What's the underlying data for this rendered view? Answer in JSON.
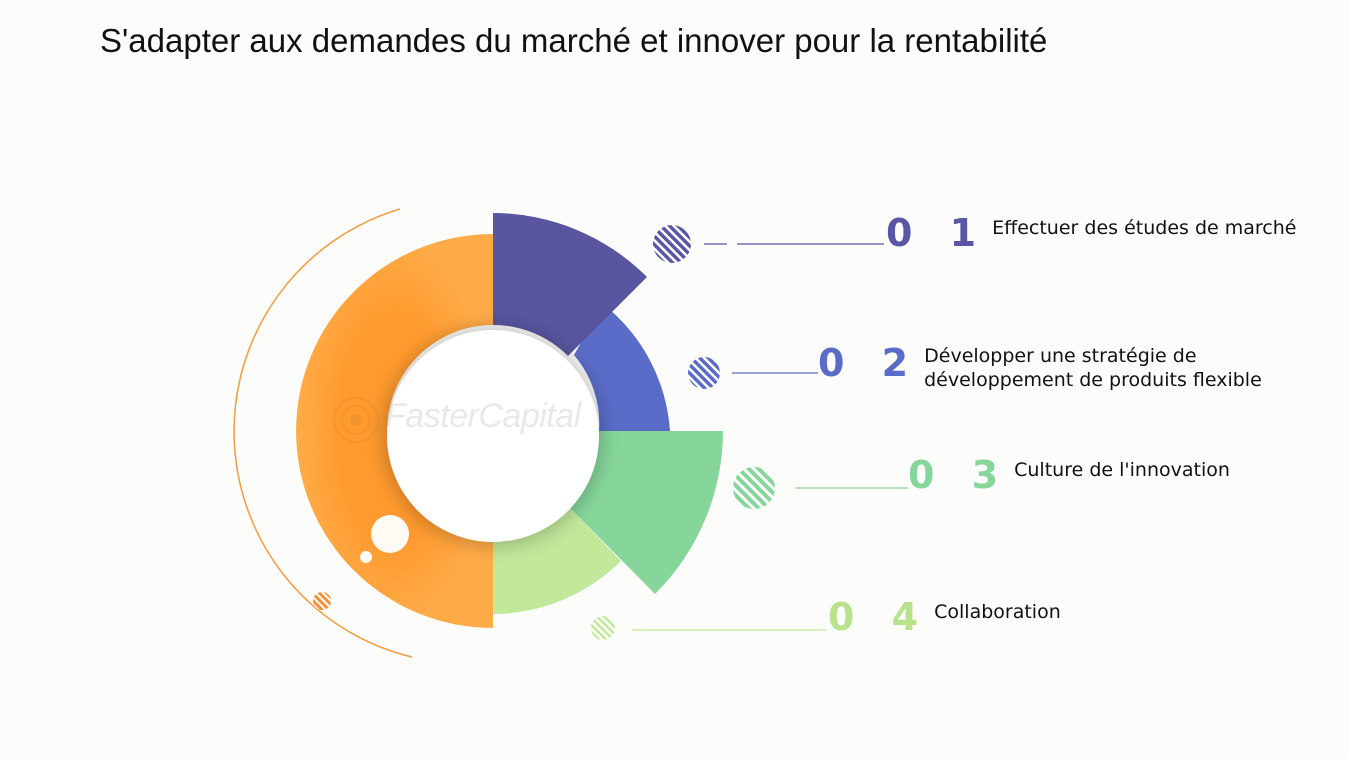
{
  "title": "S'adapter aux demandes du marché et innover pour la rentabilité",
  "watermark": "FasterCapital",
  "steps": [
    {
      "number": "0 1",
      "label": "Effectuer des études de marché",
      "color": "#5a56a6"
    },
    {
      "number": "0 2",
      "label": "Développer une stratégie de\ndéveloppement de produits flexible",
      "color": "#5b6cc8"
    },
    {
      "number": "0 3",
      "label": "Culture de l'innovation",
      "color": "#86d69b"
    },
    {
      "number": "0 4",
      "label": "Collaboration",
      "color": "#b8e38c"
    }
  ],
  "colors": {
    "orange": "#ff9f3b",
    "purple": "#5a56a6",
    "blue": "#5b6cc8",
    "green": "#86d69b",
    "lightgreen": "#c2e89a"
  }
}
